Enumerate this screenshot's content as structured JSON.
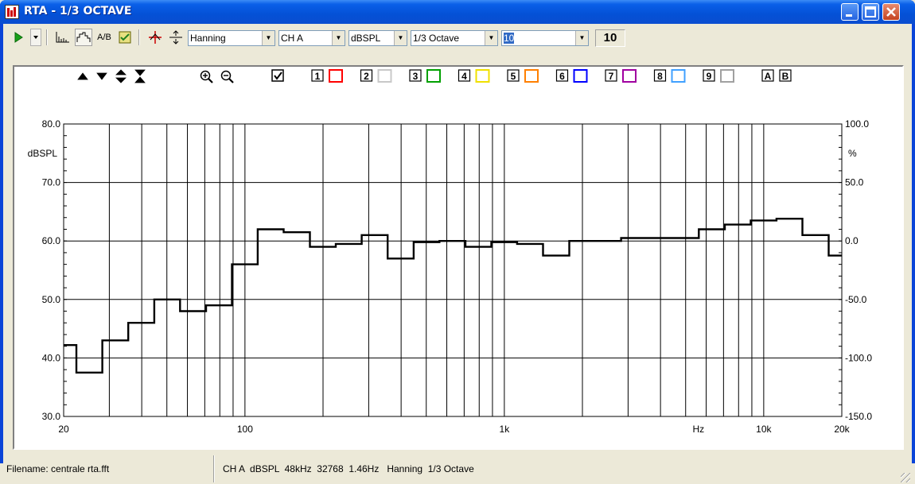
{
  "window": {
    "title": "RTA - 1/3 OCTAVE"
  },
  "toolbar": {
    "window_combo": "Hanning",
    "channel_combo": "CH A",
    "units_combo": "dBSPL",
    "resolution_combo": "1/3 Octave",
    "average_combo": "10",
    "average_count": "10",
    "icons": [
      "play-icon",
      "dropdown-arrow-icon",
      "bar-graph-icon",
      "line-graph-icon",
      "a-b-icon",
      "check-settings-icon",
      "cursor-cross-icon",
      "cursor-mid-icon"
    ]
  },
  "graph_controls": {
    "scroll_up": "▲",
    "scroll_down": "▼",
    "expand": "⬍",
    "compress": "⧗",
    "channel_labels": [
      "1",
      "2",
      "3",
      "4",
      "5",
      "6",
      "7",
      "8",
      "9"
    ],
    "channel_colors": [
      "#ff0000",
      "#c8c8c8",
      "#00a000",
      "#f0e000",
      "#ff8000",
      "#0000ff",
      "#a000a0",
      "#40a0ff",
      "#a0a0a0"
    ],
    "extra_labels": [
      "A",
      "B"
    ]
  },
  "chart_data": {
    "type": "line",
    "x_scale": "log",
    "x_range": [
      20,
      20000
    ],
    "ylim": [
      30,
      80
    ],
    "y2lim": [
      -150,
      100
    ],
    "ylabel": "dBSPL",
    "y2label": "%",
    "x_unit_label": "Hz",
    "x_tick_labels": [
      {
        "value": 20,
        "label": "20"
      },
      {
        "value": 100,
        "label": "100"
      },
      {
        "value": 1000,
        "label": "1k"
      },
      {
        "value": 10000,
        "label": "10k"
      },
      {
        "value": 20000,
        "label": "20k"
      }
    ],
    "y_tick_labels": [
      "80.0",
      "70.0",
      "60.0",
      "50.0",
      "40.0",
      "30.0"
    ],
    "y2_tick_labels": [
      "100.0",
      "50.0",
      "0.0",
      "-50.0",
      "-100.0",
      "-150.0"
    ],
    "grid_x": [
      20,
      30,
      40,
      50,
      60,
      70,
      80,
      90,
      100,
      200,
      300,
      400,
      500,
      600,
      700,
      800,
      900,
      1000,
      2000,
      3000,
      4000,
      5000,
      6000,
      7000,
      8000,
      9000,
      10000,
      20000
    ],
    "grid_y": [
      40,
      50,
      60,
      70
    ],
    "series": [
      {
        "color": "#000000",
        "bands": [
          {
            "f_lo": 20,
            "f_hi": 22.4,
            "db": 42.2
          },
          {
            "f_lo": 22.4,
            "f_hi": 28.2,
            "db": 37.5
          },
          {
            "f_lo": 28.2,
            "f_hi": 35.5,
            "db": 43.0
          },
          {
            "f_lo": 35.5,
            "f_hi": 44.7,
            "db": 46.0
          },
          {
            "f_lo": 44.7,
            "f_hi": 56.2,
            "db": 50.0
          },
          {
            "f_lo": 56.2,
            "f_hi": 70.8,
            "db": 48.0
          },
          {
            "f_lo": 70.8,
            "f_hi": 89.1,
            "db": 49.0
          },
          {
            "f_lo": 89.1,
            "f_hi": 112,
            "db": 56.0
          },
          {
            "f_lo": 112,
            "f_hi": 141,
            "db": 62.0
          },
          {
            "f_lo": 141,
            "f_hi": 178,
            "db": 61.5
          },
          {
            "f_lo": 178,
            "f_hi": 224,
            "db": 59.0
          },
          {
            "f_lo": 224,
            "f_hi": 282,
            "db": 59.5
          },
          {
            "f_lo": 282,
            "f_hi": 355,
            "db": 61.0
          },
          {
            "f_lo": 355,
            "f_hi": 447,
            "db": 57.0
          },
          {
            "f_lo": 447,
            "f_hi": 562,
            "db": 59.8
          },
          {
            "f_lo": 562,
            "f_hi": 708,
            "db": 60.0
          },
          {
            "f_lo": 708,
            "f_hi": 891,
            "db": 59.0
          },
          {
            "f_lo": 891,
            "f_hi": 1120,
            "db": 59.8
          },
          {
            "f_lo": 1120,
            "f_hi": 1410,
            "db": 59.5
          },
          {
            "f_lo": 1410,
            "f_hi": 1780,
            "db": 57.5
          },
          {
            "f_lo": 1780,
            "f_hi": 2240,
            "db": 60.0
          },
          {
            "f_lo": 2240,
            "f_hi": 2820,
            "db": 60.0
          },
          {
            "f_lo": 2820,
            "f_hi": 3550,
            "db": 60.5
          },
          {
            "f_lo": 3550,
            "f_hi": 4470,
            "db": 60.5
          },
          {
            "f_lo": 4470,
            "f_hi": 5620,
            "db": 60.5
          },
          {
            "f_lo": 5620,
            "f_hi": 7080,
            "db": 62.0
          },
          {
            "f_lo": 7080,
            "f_hi": 8910,
            "db": 62.8
          },
          {
            "f_lo": 8910,
            "f_hi": 11200,
            "db": 63.5
          },
          {
            "f_lo": 11200,
            "f_hi": 14100,
            "db": 63.8
          },
          {
            "f_lo": 14100,
            "f_hi": 17800,
            "db": 61.0
          },
          {
            "f_lo": 17800,
            "f_hi": 20000,
            "db": 57.5
          }
        ]
      }
    ]
  },
  "status": {
    "filename": "Filename: centrale rta.fft",
    "info": "CH A  dBSPL  48kHz  32768  1.46Hz   Hanning  1/3 Octave"
  }
}
